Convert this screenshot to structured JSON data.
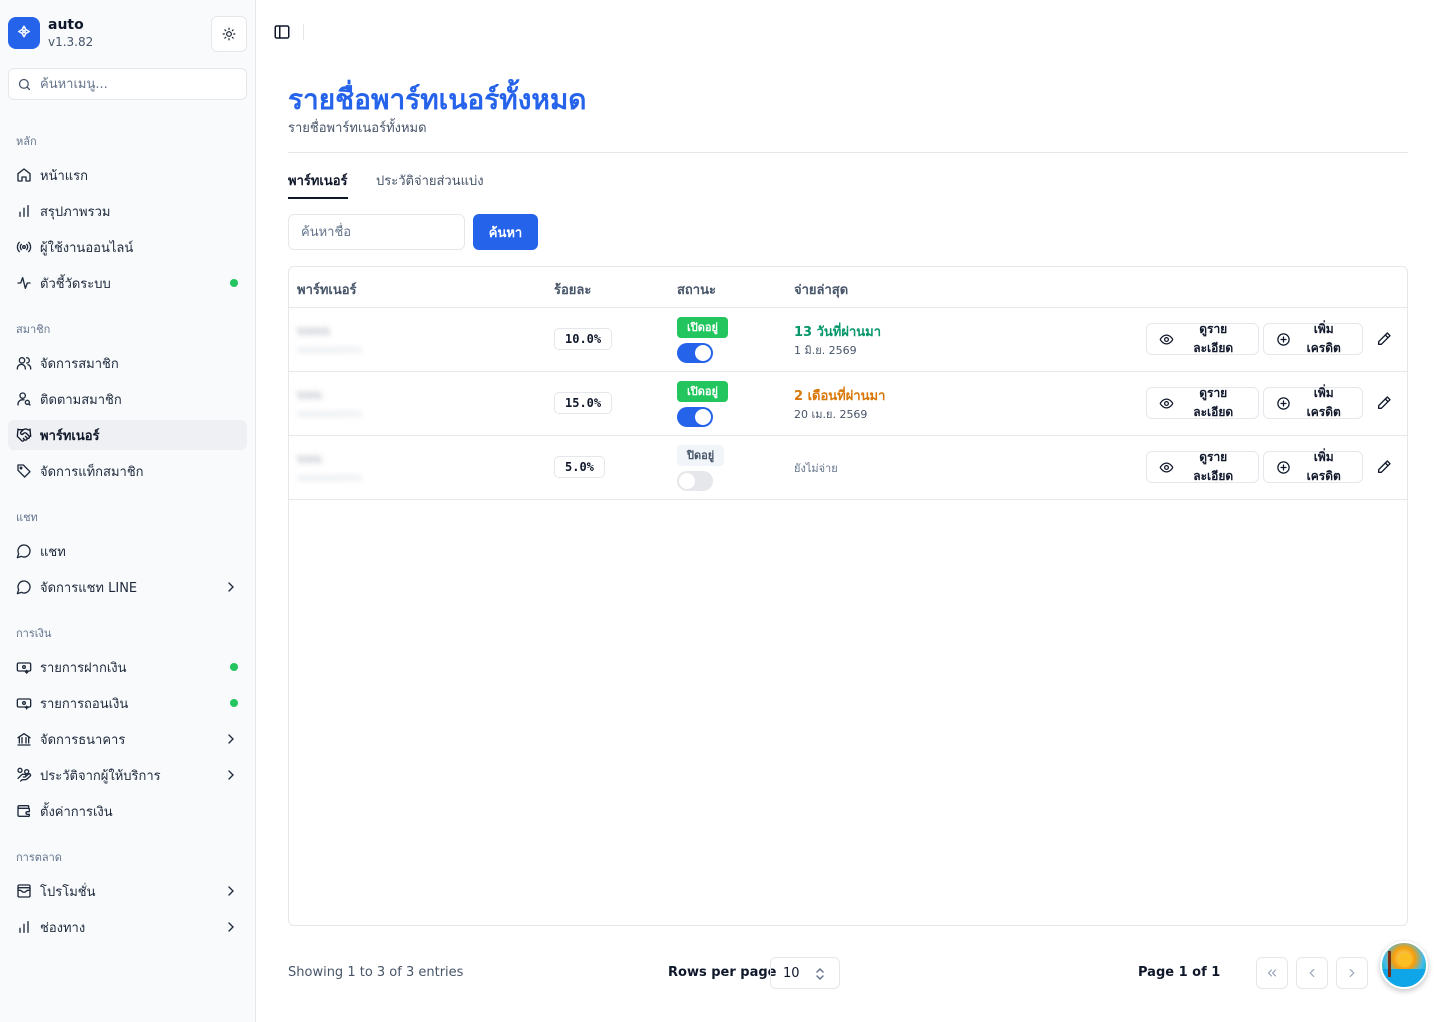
{
  "brand": {
    "name": "auto",
    "version": "v1.3.82"
  },
  "sidebar": {
    "search_placeholder": "ค้นหาเมนู...",
    "sections": {
      "main": "หลัก",
      "members": "สมาชิก",
      "chat": "แชท",
      "finance": "การเงิน",
      "marketing": "การตลาด"
    },
    "items": {
      "home": "หน้าแรก",
      "overview": "สรุปภาพรวม",
      "online_users": "ผู้ใช้งานออนไลน์",
      "system_metrics": "ตัวชี้วัดระบบ",
      "manage_members": "จัดการสมาชิก",
      "track_members": "ติดตามสมาชิก",
      "partners": "พาร์ทเนอร์",
      "member_tags": "จัดการแท็กสมาชิก",
      "chat": "แชท",
      "line_chat": "จัดการแชท LINE",
      "deposits": "รายการฝากเงิน",
      "withdrawals": "รายการถอนเงิน",
      "banks": "จัดการธนาคาร",
      "provider_history": "ประวัติจากผู้ให้บริการ",
      "finance_settings": "ตั้งค่าการเงิน",
      "promotions": "โปรโมชั่น",
      "channels": "ช่องทาง"
    },
    "status_color": "#22c55e"
  },
  "page": {
    "title": "รายชื่อพาร์ทเนอร์ทั้งหมด",
    "subtitle": "รายชื่อพาร์ทเนอร์ทั้งหมด",
    "accent_color": "#2563eb"
  },
  "tabs": [
    {
      "label": "พาร์ทเนอร์",
      "active": true
    },
    {
      "label": "ประวัติจ่ายส่วนแบ่ง",
      "active": false
    }
  ],
  "search": {
    "placeholder": "ค้นหาชื่อ",
    "button_label": "ค้นหา"
  },
  "table": {
    "columns": [
      "พาร์ทเนอร์",
      "ร้อยละ",
      "สถานะ",
      "จ่ายล่าสุด"
    ],
    "rows": [
      {
        "name": "ขขขข",
        "username": "xxxxxxxxxx",
        "percent": "10.0%",
        "status": "เปิดอยู่",
        "enabled": true,
        "last_paid_relative": "13 วันที่ผ่านมา",
        "last_paid_date": "1 มิ.ย. 2569",
        "relative_color": "#059669"
      },
      {
        "name": "ขขข",
        "username": "xxxxxxxxxx",
        "percent": "15.0%",
        "status": "เปิดอยู่",
        "enabled": true,
        "last_paid_relative": "2 เดือนที่ผ่านมา",
        "last_paid_date": "20 เม.ย. 2569",
        "relative_color": "#d97706"
      },
      {
        "name": "ขขข",
        "username": "xxxxxxxxxx",
        "percent": "5.0%",
        "status": "ปิดอยู่",
        "enabled": false,
        "last_paid_text": "ยังไม่จ่าย"
      }
    ],
    "actions": {
      "view_details": "ดูรายละเอียด",
      "add_credit": "เพิ่มเครดิต"
    }
  },
  "pagination": {
    "showing_text": "Showing 1 to 3 of 3 entries",
    "rows_per_page_label": "Rows per page",
    "rows_per_page_value": "10",
    "page_text": "Page 1 of 1"
  }
}
